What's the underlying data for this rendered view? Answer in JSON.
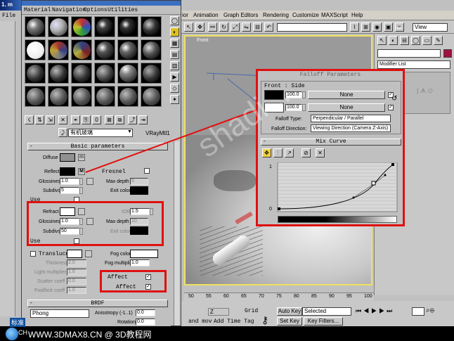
{
  "menus": {
    "left": [
      "File"
    ],
    "mtl_editor": [
      "Material",
      "Navigation",
      "Options",
      "Utilities"
    ],
    "max": [
      "Animation",
      "Graph Editors",
      "Rendering",
      "Customize",
      "MAXScript",
      "Help"
    ],
    "max_partial": "ior"
  },
  "mtl_title_fragment": "1. m",
  "viewport": {
    "label": "Front",
    "view_dropdown": "View",
    "timeline_ticks": [
      "50",
      "55",
      "60",
      "65",
      "70",
      "75",
      "80",
      "85",
      "90",
      "95",
      "100"
    ]
  },
  "command_panel": {
    "modifier_list": "Modifier List"
  },
  "material": {
    "name": "有机玻璃",
    "type": "VRayMtl1"
  },
  "basic_params": {
    "header": "Basic parameters",
    "diffuse_label": "Diffuse",
    "diffuse_map": "m",
    "reflect_label": "Reflect",
    "reflect_map": "M",
    "fresnel_label": "Fresnel",
    "glossiness_label": "Glossiness",
    "glossiness_value": "1.0",
    "max_depth_label": "Max depth",
    "max_depth_value": "5",
    "subdivs_label": "Subdivs",
    "subdivs_value": "5",
    "exit_color_label": "Exit color",
    "use_label": "Use",
    "refract_label": "Refract",
    "ior_label": "IOR",
    "ior_value": "1.5",
    "refr_glossiness_value": "1.0",
    "refr_max_depth_value": "10",
    "refr_subdivs_value": "50",
    "use2_label": "Use",
    "translucent_label": "Transluce",
    "fog_color_label": "Fog color",
    "thickness_label": "Thickness",
    "thickness_value": "2.0",
    "fog_multiplier_label": "Fog multiplier",
    "fog_multiplier_value": "1.0",
    "light_multiplier_label": "Light multiplier",
    "light_multiplier_value": "1.0",
    "scatter_coeff_label": "Scatter coeff",
    "scatter_coeff_value": "0.0",
    "fwd_bck_label": "Fwd/bck coeff",
    "fwd_bck_value": "1.0",
    "affect_label_1": "Affect",
    "affect_label_2": "Affect"
  },
  "brdf": {
    "header": "BRDF",
    "type": "Phong",
    "anisotropy_label": "Anisotropy (-1..1)",
    "anisotropy_value": "0.0",
    "rotation_label": "Rotation",
    "rotation_value": "0.0"
  },
  "falloff": {
    "title": "Falloff Parameters",
    "group_label": "Front : Side",
    "front_amount": "100.0",
    "side_amount": "100.0",
    "front_map": "None",
    "side_map": "None",
    "falloff_type_label": "Falloff Type:",
    "falloff_type_value": "Perpendicular / Parallel",
    "falloff_direction_label": "Falloff Direction:",
    "falloff_direction_value": "Viewing Direction (Camera Z-Axis)"
  },
  "mix_curve": {
    "title": "Mix Curve",
    "y_top": "1",
    "y_bottom": "0"
  },
  "status_bar": {
    "selected": "Selected",
    "auto_key": "Auto Key",
    "set_key": "Set Key",
    "key_filters": "Key Filters...",
    "grid": "Grid",
    "z_field": "Z",
    "add_time_tag": "Add Time Tag",
    "and_text": "and mov"
  },
  "taskbar": {
    "start_fragment": "标准",
    "lang": "CH",
    "watermark": "WWW.3DMAX8.CN @ 3D教程网"
  },
  "watermark_diag": "shadi..."
}
